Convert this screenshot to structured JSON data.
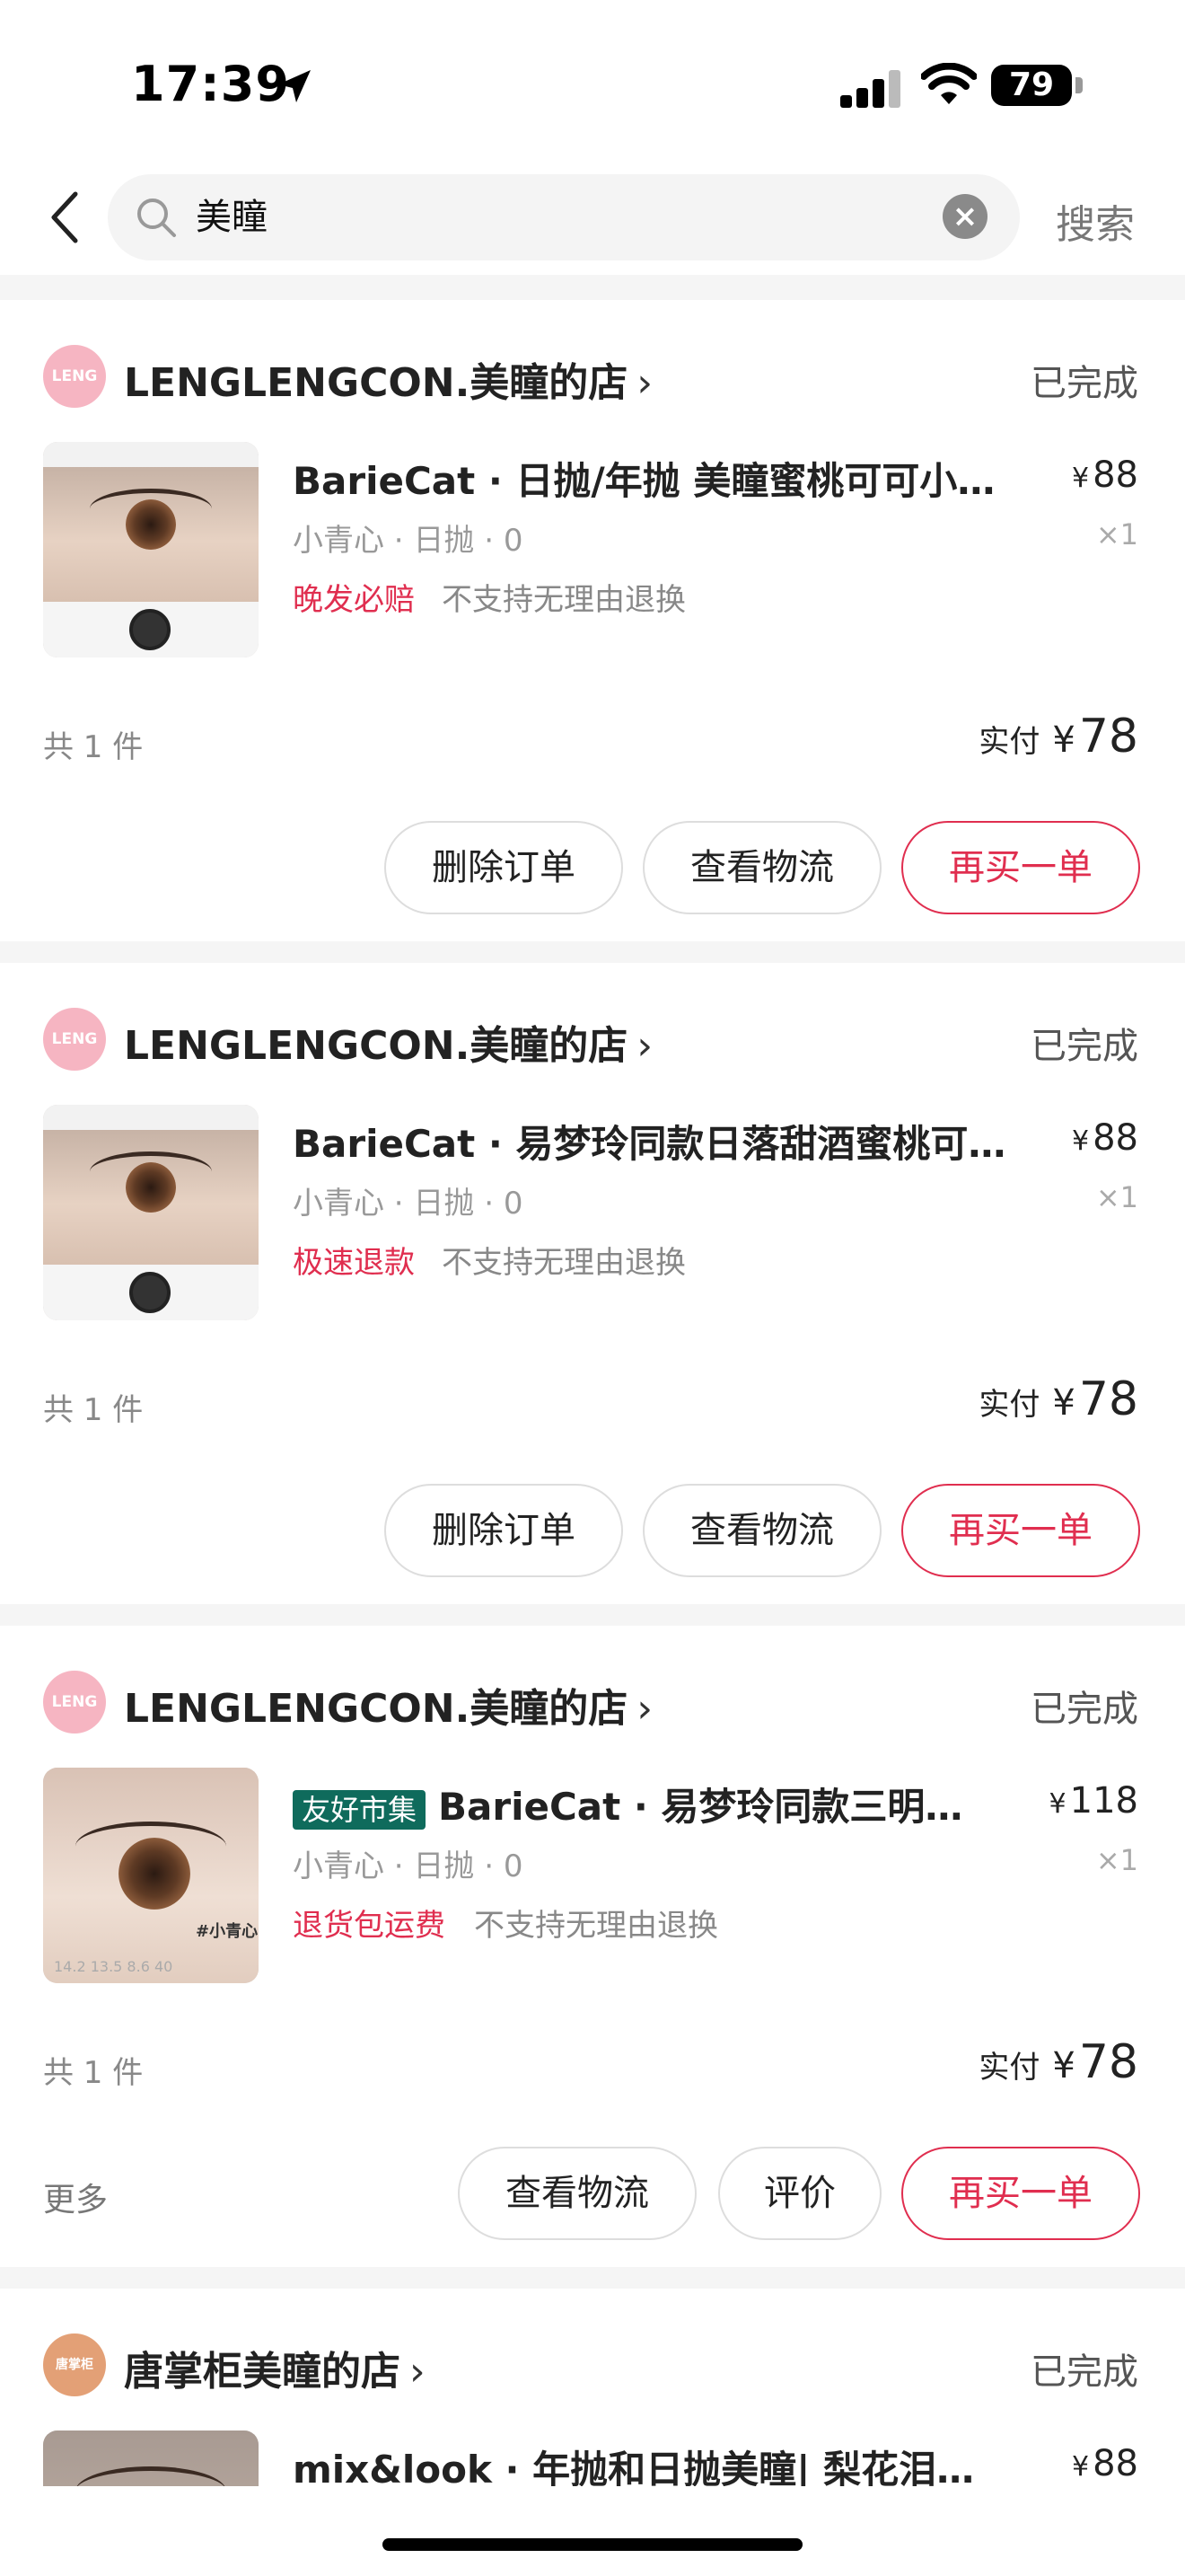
{
  "status_bar": {
    "time": "17:39",
    "battery": "79"
  },
  "search": {
    "query": "美瞳",
    "button_label": "搜索"
  },
  "orders": [
    {
      "shop_name": "LENGLENGCON.美瞳的店",
      "shop_logo_text": "LENG",
      "status": "已完成",
      "badge": "",
      "product_title": "BarieCat · 日抛/年抛 美瞳蜜桃可可小青心",
      "price": "88",
      "variant": "小青心 · 日抛 · 0",
      "quantity": "×1",
      "service_tag": "晚发必赔",
      "return_policy": "不支持无理由退换",
      "item_count": "共 1 件",
      "paid_label": "实付",
      "paid_amount": "78",
      "more_label": "",
      "buttons": [
        "删除订单",
        "查看物流",
        "再买一单"
      ]
    },
    {
      "shop_name": "LENGLENGCON.美瞳的店",
      "shop_logo_text": "LENG",
      "status": "已完成",
      "badge": "",
      "product_title": "BarieCat · 易梦玲同款日落甜酒蜜桃可可小青心",
      "price": "88",
      "variant": "小青心 · 日抛 · 0",
      "quantity": "×1",
      "service_tag": "极速退款",
      "return_policy": "不支持无理由退换",
      "item_count": "共 1 件",
      "paid_label": "实付",
      "paid_amount": "78",
      "more_label": "",
      "buttons": [
        "删除订单",
        "查看物流",
        "再买一单"
      ]
    },
    {
      "shop_name": "LENGLENGCON.美瞳的店",
      "shop_logo_text": "LENG",
      "status": "已完成",
      "badge": "友好市集",
      "product_title": "BarieCat · 易梦玲同款三明治工厂小青心",
      "price": "118",
      "variant": "小青心 · 日抛 · 0",
      "quantity": "×1",
      "service_tag": "退货包运费",
      "return_policy": "不支持无理由退换",
      "item_count": "共 1 件",
      "paid_label": "实付",
      "paid_amount": "78",
      "more_label": "更多",
      "thumb_tag": "#小青心",
      "thumb_nums": "14.2  13.5  8.6  40",
      "buttons": [
        "查看物流",
        "评价",
        "再买一单"
      ]
    },
    {
      "shop_name": "唐掌柜美瞳的店",
      "shop_logo_text": "唐掌柜",
      "status": "已完成",
      "product_title": "mix&look · 年抛和日抛美瞳| 梨花泪、中国风",
      "price": "88"
    }
  ]
}
